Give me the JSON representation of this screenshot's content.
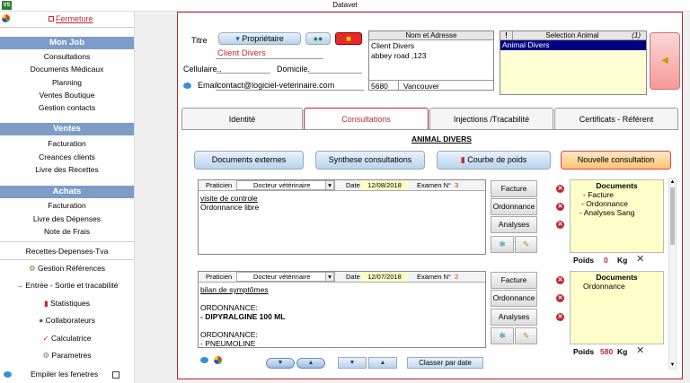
{
  "window": {
    "title": "Datavet",
    "icon_text": "VS"
  },
  "sidebar": {
    "close_label": "Fermeture",
    "sections": [
      {
        "title": "Mon Job",
        "items": [
          "Consultations",
          "Documents Médicaux",
          "Planning",
          "Ventes Boutique",
          "Gestion contacts"
        ]
      },
      {
        "title": "Ventes",
        "items": [
          "Facturation",
          "Creances clients",
          "Livre des Recettes"
        ]
      },
      {
        "title": "Achats",
        "items": [
          "Facturation",
          "Livre des Dépenses",
          "Note de Frais"
        ]
      }
    ],
    "tools": [
      "Recettes-Depenses-Tva",
      "Gestion Références",
      "Entrée - Sortie et tracabilité",
      "Statistiques",
      "Collaborateurs",
      "Calculatrice",
      "Parametres"
    ],
    "stack_windows_label": "Empiler les fenetres"
  },
  "client": {
    "titre_label": "Titre",
    "proprietaire_label": "Propriétaire",
    "name": "Client Divers",
    "cellulaire_label": "Cellulaire..",
    "domicile_label": "Domicile.",
    "email_label": "Email",
    "email": "contact@logiciel-veterinaire.com",
    "address_header": "Nom et Adresse",
    "address_lines": [
      "Client Divers",
      "abbey road ,123"
    ],
    "postal": "5680",
    "city": "Vancouver"
  },
  "animal": {
    "header": "Selection Animal",
    "count": "(1)",
    "selected": "Animal Divers",
    "bang": "!"
  },
  "tabs": [
    "Identité",
    "Consultations",
    "Injections /Tracabilité",
    "Certificats - Référent"
  ],
  "consult": {
    "animal_title": "ANIMAL DIVERS",
    "buttons": {
      "docs": "Documents externes",
      "synthese": "Synthese consultations",
      "courbe": "Courbe de poids",
      "nouvelle": "Nouvelle consultation"
    },
    "entries": [
      {
        "praticien_label": "Praticien",
        "praticien": "Docteur vétérinaire",
        "date_label": "Date",
        "date": "12/08/2018",
        "exam_label": "Examen  N°",
        "exam": "3",
        "lines": [
          "visite de controle",
          "Ordonnance libre"
        ],
        "actions": [
          "Facture",
          "Ordonnance",
          "Analyses Sang"
        ],
        "docs_title": "Documents",
        "docs": [
          "- Facture",
          "- Ordonnance",
          "- Analyses Sang"
        ],
        "poids_label": "Poids",
        "poids": "0",
        "kg": "Kg"
      },
      {
        "praticien_label": "Praticien",
        "praticien": "Docteur vétérinaire",
        "date_label": "Date",
        "date": "12/07/2018",
        "exam_label": "Examen  N°",
        "exam": "2",
        "lines": [
          "bilan de symptômes",
          "",
          "ORDONNANCE:",
          "- DIPYRALGINE 100 ML",
          "",
          "ORDONNANCE:",
          "- PNEUMOLINE"
        ],
        "actions": [
          "Facture",
          "Ordonnance",
          "Analyses Sang"
        ],
        "docs_title": "Documents",
        "docs": [
          "Ordonnance"
        ],
        "poids_label": "Poids",
        "poids": "580",
        "kg": "Kg"
      }
    ],
    "sort_label": "Classer par date"
  },
  "colors": {
    "accent": "#7d9dc8",
    "danger": "#c0272d",
    "selection": "#000080"
  }
}
